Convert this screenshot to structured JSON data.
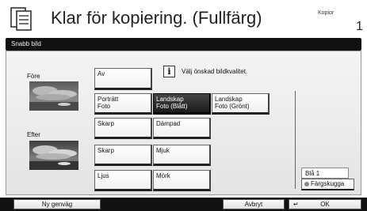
{
  "header": {
    "title": "Klar för kopiering. (Fullfärg)",
    "kopior_label": "Kopior",
    "kopior_count": "1",
    "doc_icon": "document-icon"
  },
  "panel": {
    "title": "Snabb bild",
    "before_label": "Före",
    "after_label": "Efter",
    "info_glyph": "i",
    "info_text": "Välj önskad bildkvalitet.",
    "buttons": {
      "av": "Av",
      "portratt_1": "Porträtt",
      "portratt_2": "Foto",
      "landskap_blatt_1": "Landskap",
      "landskap_blatt_2": "Foto (Blått)",
      "landskap_gront_1": "Landskap",
      "landskap_gront_2": "Foto (Grönt)",
      "skarp_1": "Skarp",
      "dampad": "Dämpad",
      "skarp_2": "Skarp",
      "mjuk": "Mjuk",
      "ljus": "Ljus",
      "mork": "Mörk"
    },
    "selected": "landskap_blatt",
    "side_value": "Blå 1",
    "fargskugga": "Färgskugga"
  },
  "footer": {
    "ny_genvag": "Ny genväg",
    "avbryt": "Avbryt",
    "ok": "OK"
  }
}
